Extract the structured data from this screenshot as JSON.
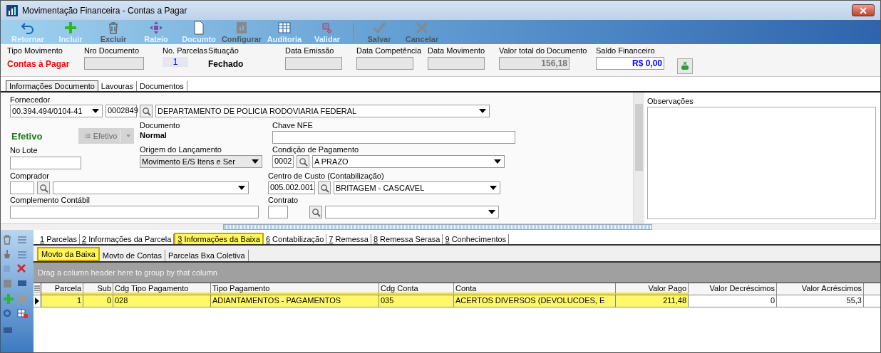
{
  "window": {
    "title": "Movimentação Financeira - Contas a Pagar"
  },
  "toolbar": [
    {
      "label": "Retornar",
      "kind": "back",
      "disabled": false
    },
    {
      "label": "Incluir",
      "kind": "plus",
      "disabled": false
    },
    {
      "label": "Excluir",
      "kind": "trash",
      "disabled": true
    },
    {
      "label": "Rateio",
      "kind": "move",
      "disabled": false
    },
    {
      "label": "Documto",
      "kind": "doc",
      "disabled": false
    },
    {
      "label": "Configurar",
      "kind": "config",
      "disabled": true
    },
    {
      "label": "Auditoria",
      "kind": "grid",
      "disabled": false
    },
    {
      "label": "Validar",
      "kind": "validate",
      "disabled": false
    },
    {
      "label": "Salvar",
      "kind": "check",
      "disabled": true
    },
    {
      "label": "Cancelar",
      "kind": "cancel",
      "disabled": true
    }
  ],
  "header": {
    "tipo": {
      "label": "Tipo Movimento",
      "value": "Contas à Pagar"
    },
    "nro": {
      "label": "Nro Documento"
    },
    "parcelas": {
      "label": "No. Parcelas",
      "value": "1"
    },
    "situacao": {
      "label": "Situação",
      "value": "Fechado"
    },
    "dates": [
      {
        "label": "Data Emissão"
      },
      {
        "label": "Data Competência"
      },
      {
        "label": "Data Movimento"
      }
    ],
    "total": {
      "label": "Valor total do Documento",
      "value": "156,18"
    },
    "saldo": {
      "label": "Saldo Financeiro",
      "value": "R$ 0,00"
    }
  },
  "tabs": [
    {
      "label": "Informações Documento",
      "selected": true
    },
    {
      "label": "Lavouras",
      "selected": false
    },
    {
      "label": "Documentos",
      "selected": false
    }
  ],
  "form": {
    "fornecedor": {
      "label": "Fornecedor",
      "cnpj": "00.394.494/0104-41",
      "code": "0002849",
      "name": "DEPARTAMENTO DE POLICIA RODOVIARIA FEDERAL"
    },
    "status": "Efetivo",
    "status_button": {
      "label": "Efetivo",
      "disabled": true
    },
    "documento": {
      "label": "Documento",
      "value": "Normal"
    },
    "chave": {
      "label": "Chave NFE"
    },
    "lote": {
      "label": "No Lote"
    },
    "origem": {
      "label": "Origem do Lançamento",
      "value": "Movimento E/S Itens e Ser"
    },
    "condicao": {
      "label": "Condição de Pagamento",
      "code": "0002",
      "name": "A PRAZO"
    },
    "comprador": {
      "label": "Comprador"
    },
    "centro": {
      "label": "Centro de Custo (Contabilização)",
      "code": "005.002.001",
      "name": "BRITAGEM - CASCAVEL"
    },
    "complemento": {
      "label": "Complemento Contábil"
    },
    "contrato": {
      "label": "Contrato"
    },
    "observacoes": {
      "label": "Observações"
    }
  },
  "detail_tabs": [
    {
      "number": "1",
      "label": "Parcelas",
      "selected": false
    },
    {
      "number": "2",
      "label": "Informações da Parcela",
      "selected": false
    },
    {
      "number": "3",
      "label": "Informações da Baixa",
      "selected": true
    },
    {
      "number": "6",
      "label": "Contabilização",
      "selected": false
    },
    {
      "number": "7",
      "label": "Remessa",
      "selected": false
    },
    {
      "number": "8",
      "label": "Remessa Serasa",
      "selected": false
    },
    {
      "number": "9",
      "label": "Conhecimentos",
      "selected": false
    }
  ],
  "sub_tabs": [
    {
      "label": "Movto da Baixa",
      "selected": true
    },
    {
      "label": "Movto de Contas",
      "selected": false
    },
    {
      "label": "Parcelas Bxa Coletiva",
      "selected": false
    }
  ],
  "group_hint": "Drag a column header here to group by that column",
  "grid": {
    "columns": [
      {
        "label": "Parcela",
        "highlighted": true
      },
      {
        "label": "Sub",
        "highlighted": true
      },
      {
        "label": "Cdg Tipo Pagamento",
        "highlighted": true
      },
      {
        "label": "Tipo Pagamento",
        "highlighted": true
      },
      {
        "label": "Cdg Conta",
        "highlighted": true
      },
      {
        "label": "Conta",
        "highlighted": true
      },
      {
        "label": "Valor Pago",
        "highlighted": true
      },
      {
        "label": "Valor Decréscimos",
        "highlighted": false
      },
      {
        "label": "Valor Acréscimos",
        "highlighted": false
      }
    ],
    "rows": [
      {
        "selected": true,
        "cells": [
          "1",
          "0",
          "028",
          "ADIANTAMENTOS - PAGAMENTOS",
          "035",
          "ACERTOS DIVERSOS (DEVOLUCOES, E",
          "211,48",
          "0",
          "55,3"
        ]
      }
    ]
  }
}
